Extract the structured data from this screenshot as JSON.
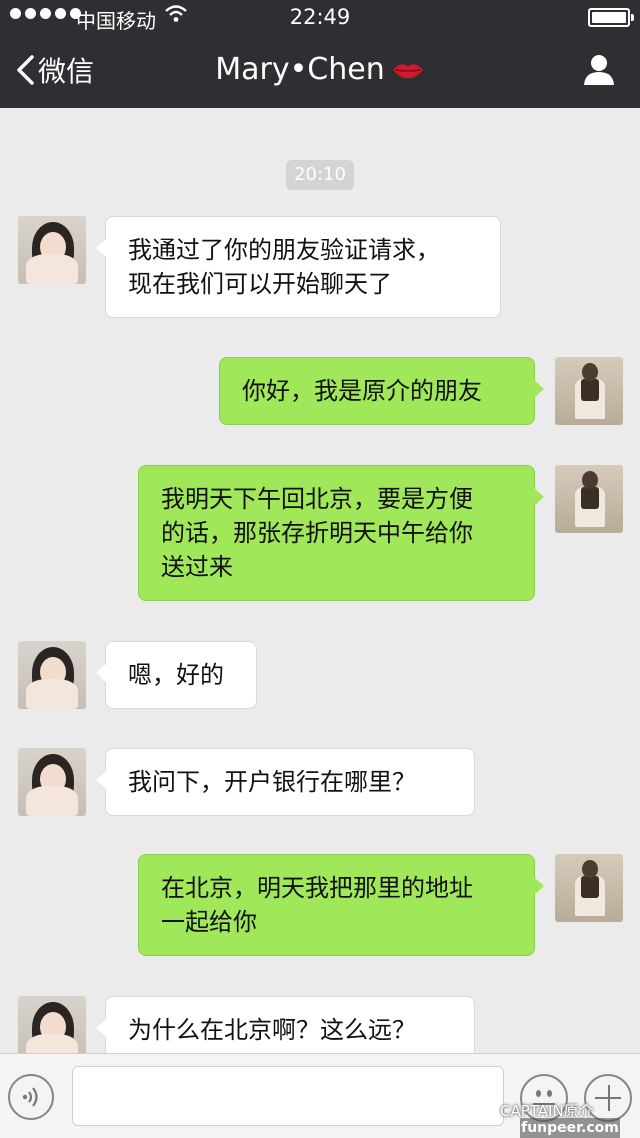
{
  "status_bar": {
    "carrier": "中国移动",
    "time": "22:49"
  },
  "nav": {
    "back_label": "微信",
    "title": "Mary•Chen",
    "title_icon": "lips-icon",
    "right_icon": "person-icon"
  },
  "chat": {
    "timestamp": "20:10",
    "messages": [
      {
        "side": "in",
        "lines": [
          "我通过了你的朋友验证请求，",
          "现在我们可以开始聊天了"
        ]
      },
      {
        "side": "out",
        "lines": [
          "你好，我是原介的朋友"
        ]
      },
      {
        "side": "out",
        "lines": [
          "我明天下午回北京，要是方便",
          "的话，那张存折明天中午给你",
          "送过来"
        ]
      },
      {
        "side": "in",
        "lines": [
          "嗯，好的"
        ]
      },
      {
        "side": "in",
        "lines": [
          "我问下，开户银行在哪里？"
        ]
      },
      {
        "side": "out",
        "lines": [
          "在北京，明天我把那里的地址",
          "一起给你"
        ]
      },
      {
        "side": "in",
        "lines": [
          "为什么在北京啊？这么远？"
        ]
      }
    ]
  },
  "input_bar": {
    "voice_icon": "voice-icon",
    "input_value": "",
    "emoji_icon": "emoji-icon",
    "plus_icon": "plus-icon"
  },
  "watermark": {
    "line1": "CAPTAIN原介",
    "line2": "funpeer.com"
  },
  "colors": {
    "header_bg": "#2f2f33",
    "chat_bg": "#ebebeb",
    "outgoing_bubble": "#a0e75a",
    "incoming_bubble": "#ffffff"
  }
}
